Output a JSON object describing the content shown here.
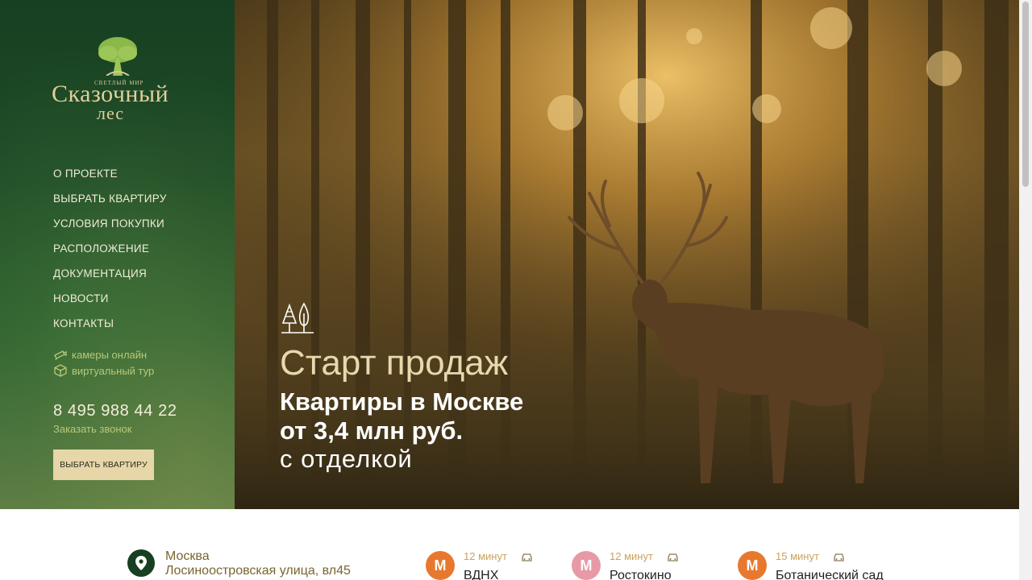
{
  "logo": {
    "small_text": "СВЕТЛЫЙ МИР",
    "main_line1": "Сказочный",
    "main_line2": "лес"
  },
  "nav": [
    {
      "label": "О ПРОЕКТЕ"
    },
    {
      "label": "ВЫБРАТЬ КВАРТИРУ"
    },
    {
      "label": "УСЛОВИЯ ПОКУПКИ"
    },
    {
      "label": "РАСПОЛОЖЕНИЕ"
    },
    {
      "label": "ДОКУМЕНТАЦИЯ"
    },
    {
      "label": "НОВОСТИ"
    },
    {
      "label": "КОНТАКТЫ"
    }
  ],
  "extra_links": [
    {
      "label": "камеры онлайн",
      "icon": "camera-icon"
    },
    {
      "label": "виртуальный тур",
      "icon": "cube-icon"
    }
  ],
  "contact": {
    "phone": "8 495 988 44 22",
    "callback_label": "Заказать звонок"
  },
  "cta": {
    "choose_apartment_label": "ВЫБРАТЬ КВАРТИРУ"
  },
  "hero": {
    "title": "Старт продаж",
    "line1": "Квартиры в Москве",
    "line2": "от 3,4 млн руб.",
    "line3": "с отделкой",
    "icon": "trees-icon"
  },
  "address": {
    "city": "Москва",
    "street": "Лосиноостровская улица, вл45"
  },
  "metro": [
    {
      "time": "12 минут",
      "name": "ВДНХ",
      "color": "#e8782e",
      "letter": "М"
    },
    {
      "time": "12 минут",
      "name": "Ростокино",
      "color": "#e79aa6",
      "letter": "М"
    },
    {
      "time": "15 минут",
      "name": "Ботанический сад",
      "color": "#e8782e",
      "letter": "М"
    }
  ],
  "colors": {
    "sidebar_dark": "#173f22",
    "gold": "#e2cf9b",
    "accent_green": "#b8c878",
    "button": "#e6d6a8"
  }
}
